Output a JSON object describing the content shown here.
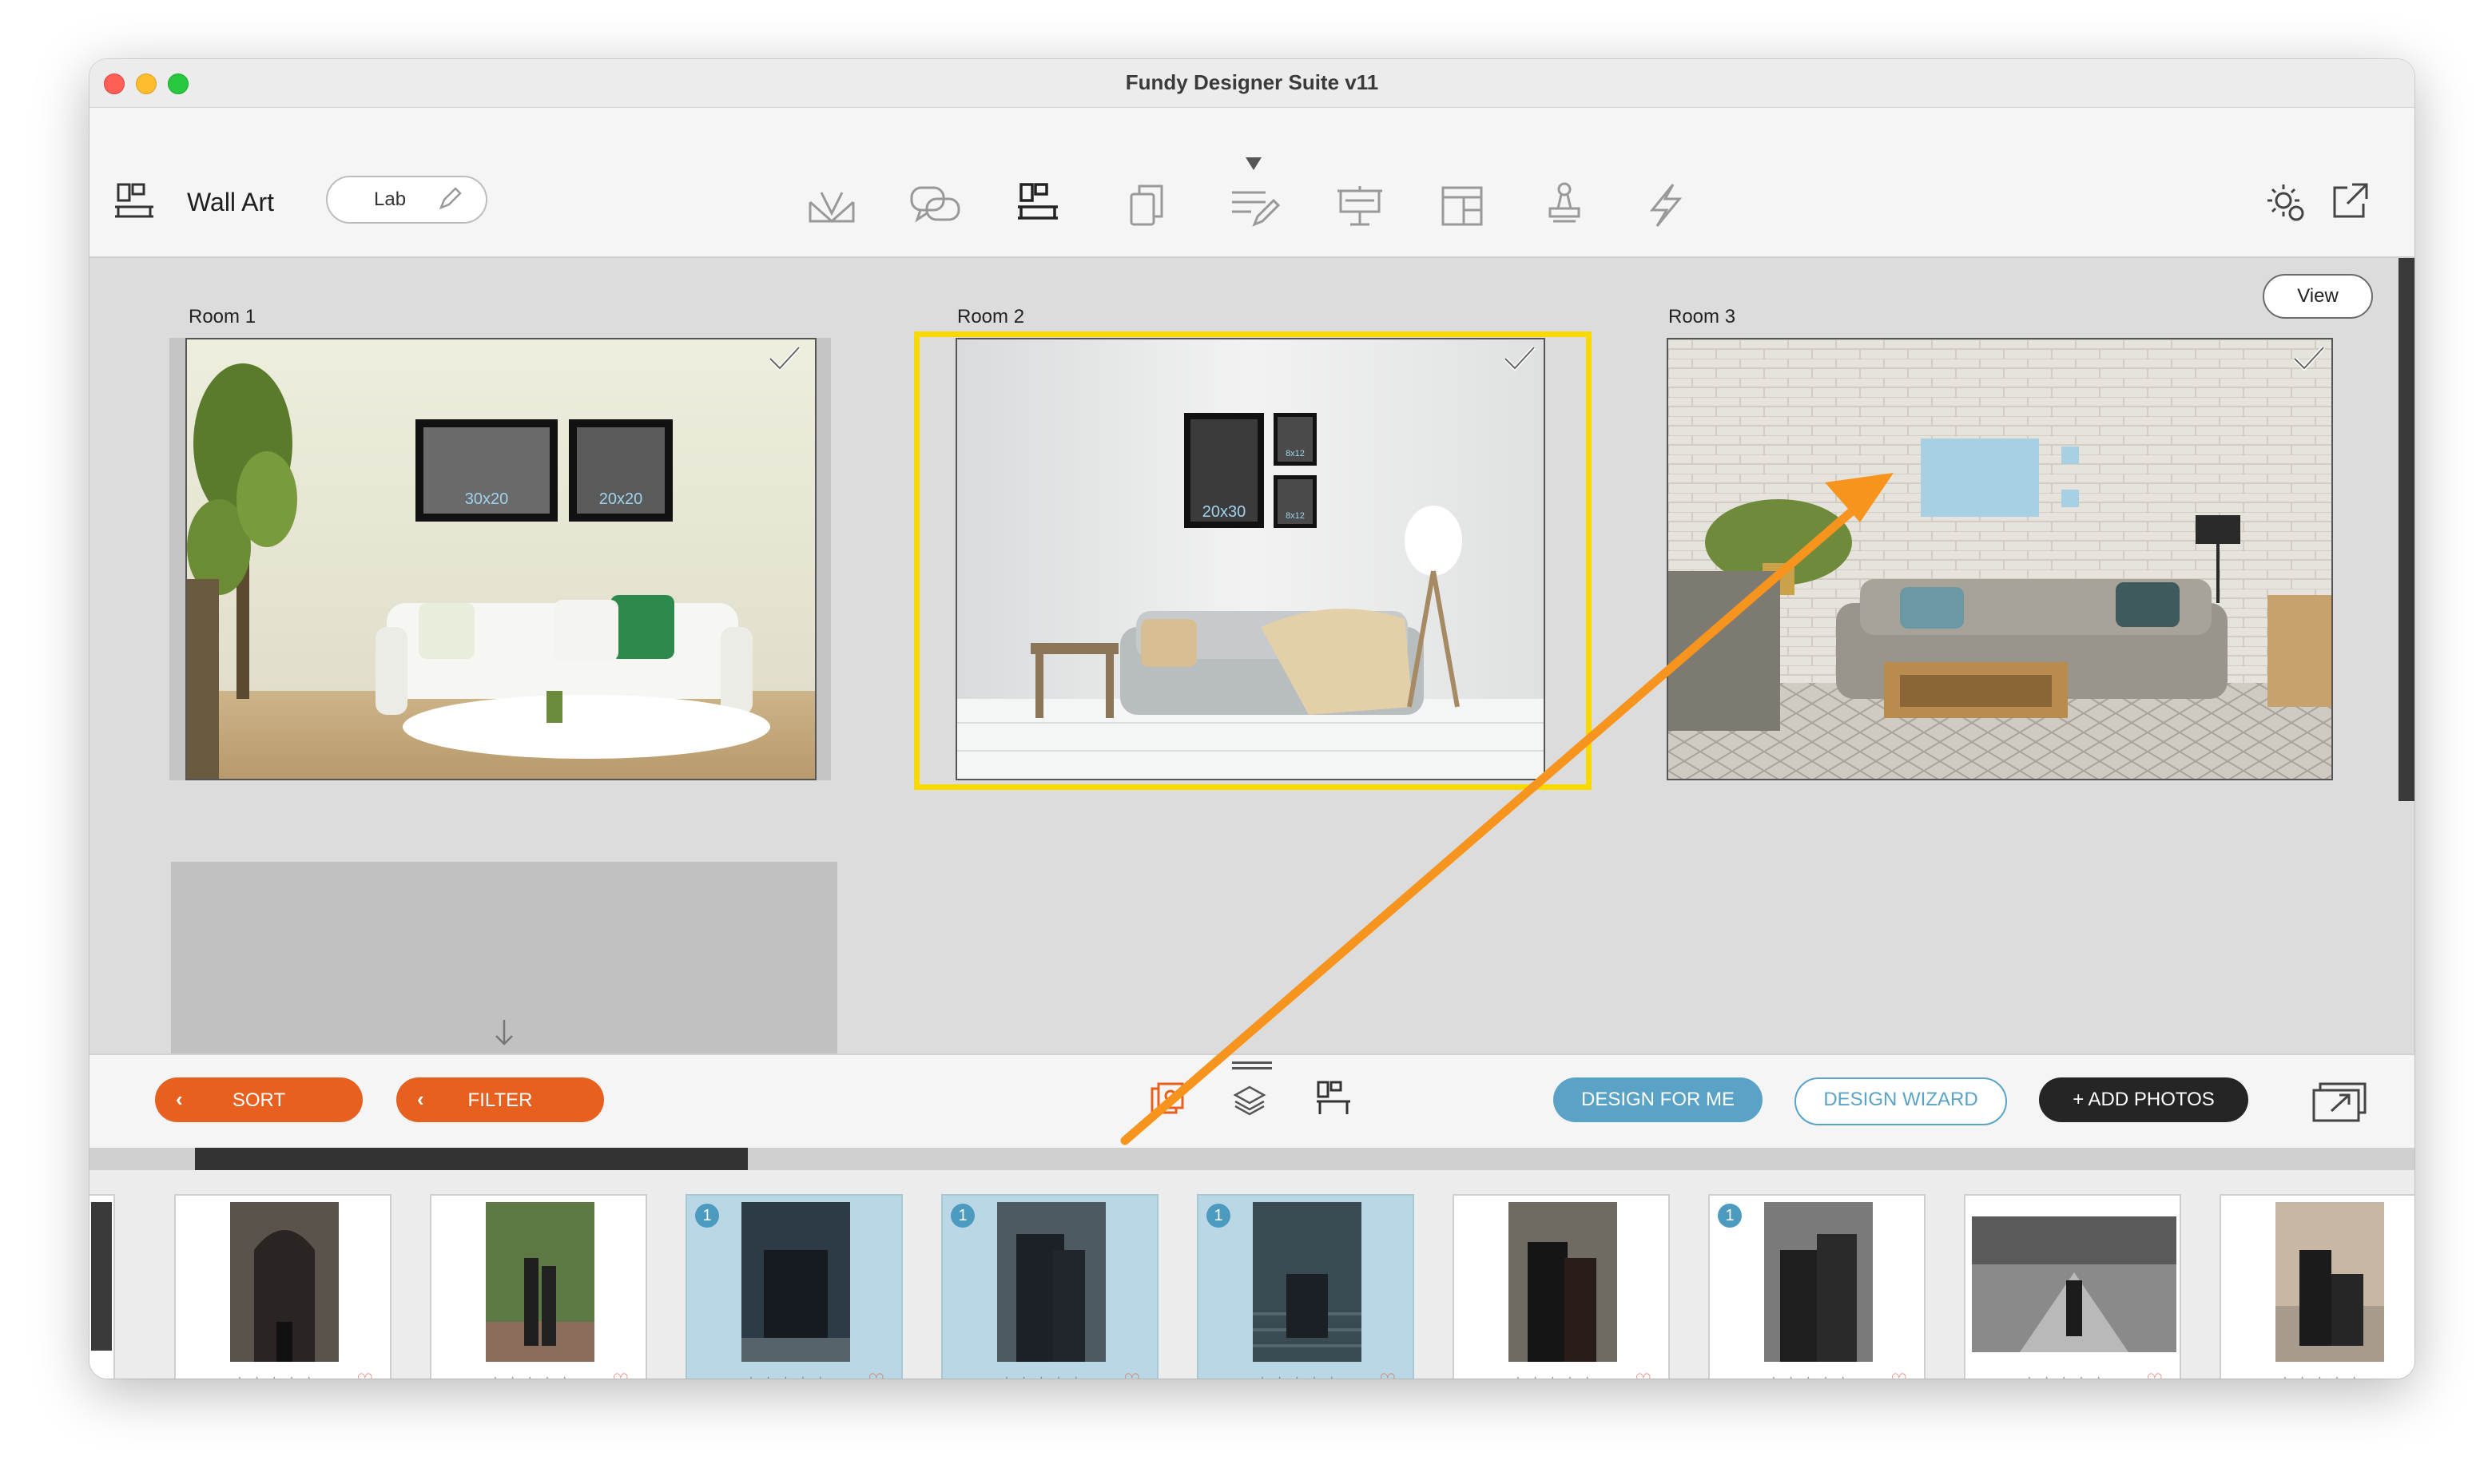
{
  "window": {
    "title": "Fundy Designer Suite v11"
  },
  "toolbar": {
    "module_title": "Wall Art",
    "lab_label": "Lab",
    "modules": [
      {
        "icon": "album-icon"
      },
      {
        "icon": "proofing-chat-icon"
      },
      {
        "icon": "wall-art-icon"
      },
      {
        "icon": "cards-icon"
      },
      {
        "icon": "blog-edit-icon"
      },
      {
        "icon": "presentation-icon"
      },
      {
        "icon": "layout-grid-icon"
      },
      {
        "icon": "stamp-icon"
      },
      {
        "icon": "brand-icon"
      }
    ],
    "right_icons": [
      "settings-gear-icon",
      "open-external-icon"
    ]
  },
  "canvas": {
    "view_label": "View",
    "rooms": [
      {
        "label": "Room 1",
        "frames": [
          "30x20",
          "20x20"
        ],
        "checked": true
      },
      {
        "label": "Room 2",
        "frames": [
          "20x30",
          "8x12",
          "8x12"
        ],
        "checked": true,
        "selected": true
      },
      {
        "label": "Room 3",
        "frames": [],
        "checked": true
      }
    ]
  },
  "bottom_bar": {
    "sort_label": "SORT",
    "filter_label": "FILTER",
    "design_for_me_label": "DESIGN FOR ME",
    "design_wizard_label": "DESIGN WIZARD",
    "add_photos_label": "+ ADD PHOTOS"
  },
  "strip": {
    "stars": "☆☆☆☆☆",
    "photos": [
      {
        "used": false
      },
      {
        "used": false
      },
      {
        "used": true,
        "count": "1"
      },
      {
        "used": true,
        "count": "1"
      },
      {
        "used": true,
        "count": "1"
      },
      {
        "used": false
      },
      {
        "used": false,
        "count": "1"
      },
      {
        "used": false
      },
      {
        "used": false
      }
    ]
  },
  "colors": {
    "accent_orange": "#e8601f",
    "design_blue": "#5aa3c7",
    "selection_yellow": "#f9d900",
    "annotation_arrow": "#f7941d"
  }
}
